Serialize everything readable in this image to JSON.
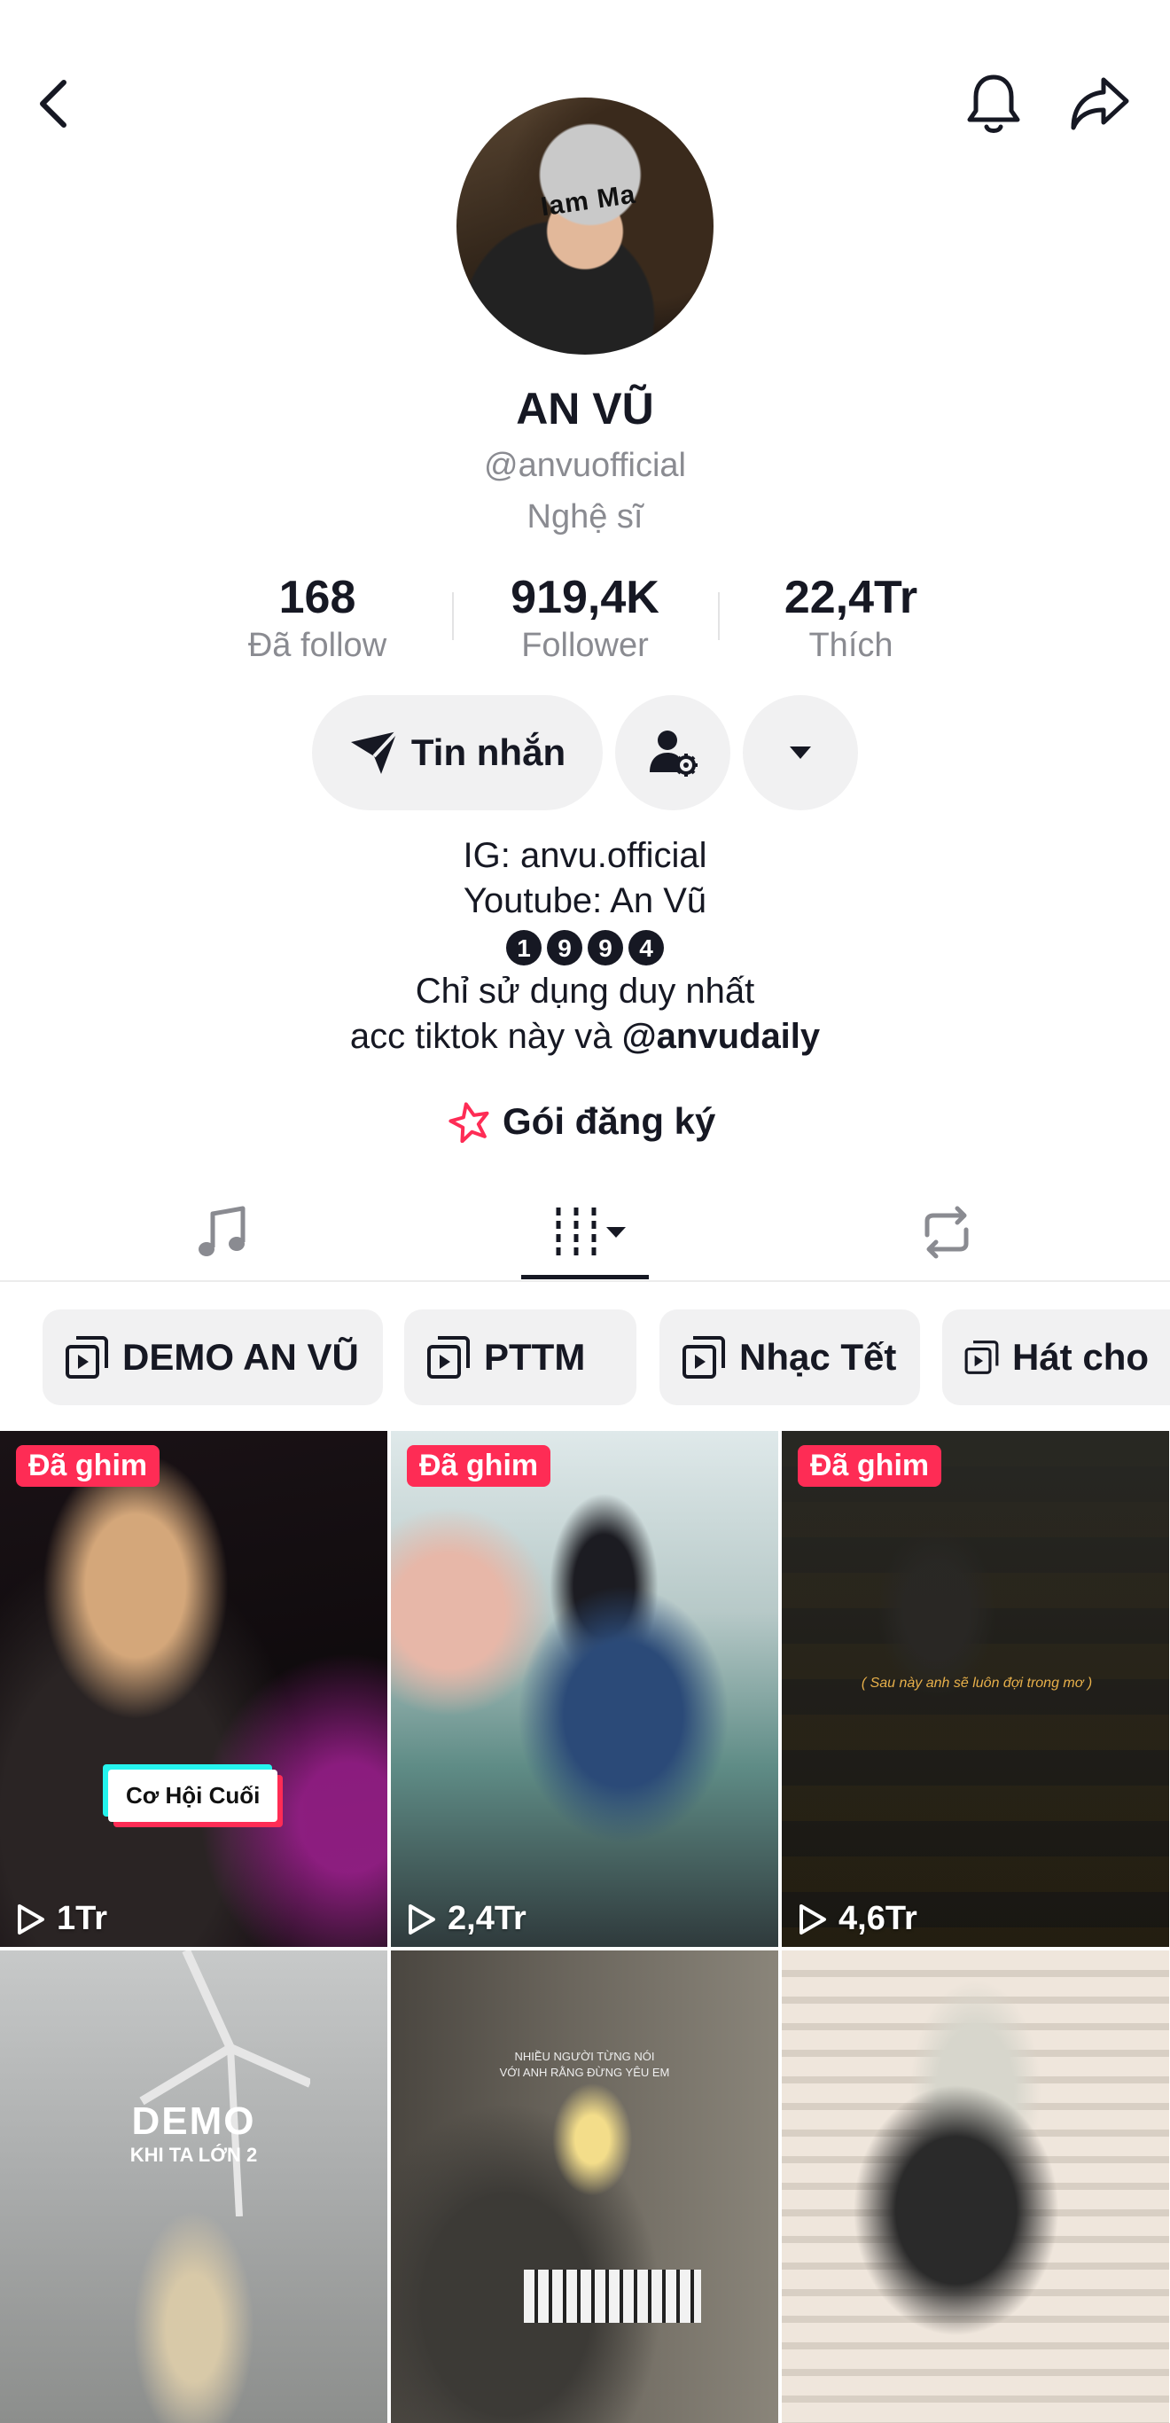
{
  "profile": {
    "name": "AN VŨ",
    "handle": "@anvuofficial",
    "role": "Nghệ sĩ",
    "avatar_cap_text": "Iam Ma"
  },
  "stats": [
    {
      "value": "168",
      "label": "Đã follow"
    },
    {
      "value": "919,4K",
      "label": "Follower"
    },
    {
      "value": "22,4Tr",
      "label": "Thích"
    }
  ],
  "actions": {
    "message_label": "Tin nhắn"
  },
  "bio": {
    "line1": "IG: anvu.official",
    "line2": "Youtube: An Vũ",
    "digits": [
      "1",
      "9",
      "9",
      "4"
    ],
    "line4": "Chỉ sử dụng duy nhất",
    "line5_prefix": "acc tiktok này và ",
    "line5_mention": "@anvudaily"
  },
  "subscription_label": "Gói đăng ký",
  "tabs": [
    {
      "icon": "music-note-icon"
    },
    {
      "icon": "grid-icon"
    },
    {
      "icon": "repost-icon"
    }
  ],
  "playlists": [
    {
      "label": "DEMO AN VŨ"
    },
    {
      "label": "PTTM"
    },
    {
      "label": "Nhạc Tết"
    },
    {
      "label": "Hát cho"
    }
  ],
  "videos": [
    {
      "pinned": "Đã ghim",
      "views": "1Tr",
      "overlay": "Cơ Hội Cuối"
    },
    {
      "pinned": "Đã ghim",
      "views": "2,4Tr"
    },
    {
      "pinned": "Đã ghim",
      "views": "4,6Tr",
      "overlay": "( Sau này anh sẽ luôn đợi trong mơ )"
    },
    {
      "overlay": "DEMO",
      "overlay2": "KHI TA LỚN 2"
    },
    {
      "overlay": "NHIỀU NGƯỜI TỪNG NÓI",
      "overlay2": "VỚI ANH RẰNG ĐỪNG YÊU EM"
    },
    {}
  ],
  "colors": {
    "accent": "#fe2c55",
    "text": "#161823",
    "muted": "#8a8b91",
    "pill_bg": "#f1f1f2"
  }
}
